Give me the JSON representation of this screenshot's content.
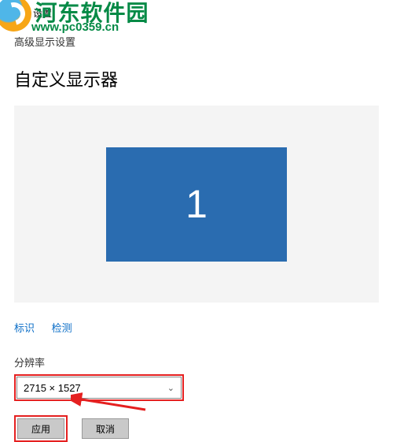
{
  "watermark": {
    "name": "河东软件园",
    "url": "www.pc0359.cn"
  },
  "titlebar": {
    "window": "设置"
  },
  "header": {
    "breadcrumb": "高级显示设置"
  },
  "page": {
    "title": "自定义显示器"
  },
  "monitor": {
    "id": "1"
  },
  "links": {
    "identify": "标识",
    "detect": "检测"
  },
  "resolution": {
    "label": "分辨率",
    "value": "2715 × 1527"
  },
  "buttons": {
    "apply": "应用",
    "cancel": "取消"
  }
}
